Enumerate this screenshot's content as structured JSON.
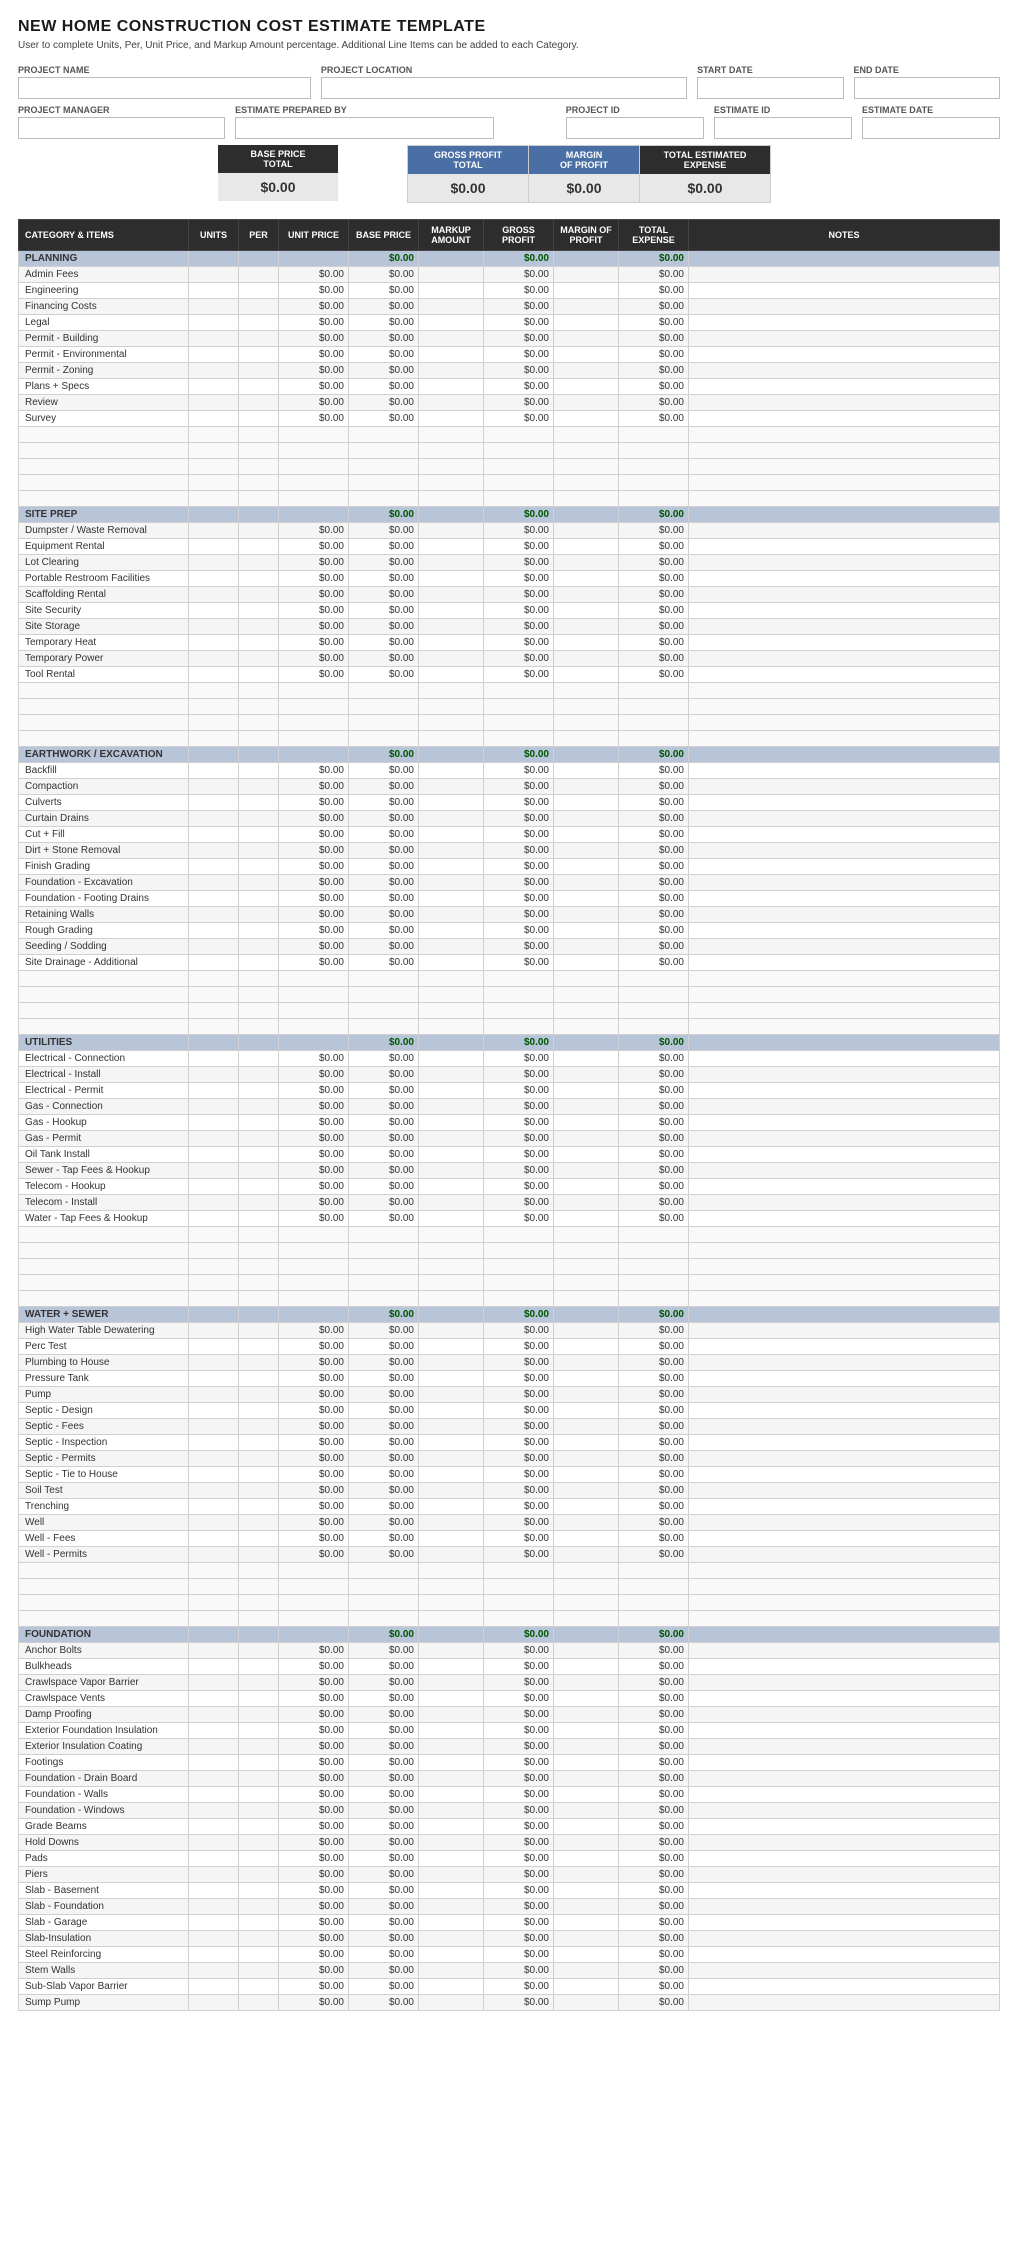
{
  "title": "NEW HOME CONSTRUCTION COST ESTIMATE TEMPLATE",
  "subtitle": "User to complete Units, Per, Unit Price, and Markup Amount percentage.  Additional Line Items can be added to each Category.",
  "form": {
    "project_name_label": "PROJECT NAME",
    "project_location_label": "PROJECT LOCATION",
    "start_date_label": "START DATE",
    "end_date_label": "END DATE",
    "project_manager_label": "PROJECT MANAGER",
    "estimate_prepared_label": "ESTIMATE PREPARED BY",
    "project_id_label": "PROJECT ID",
    "estimate_id_label": "ESTIMATE ID",
    "estimate_date_label": "ESTIMATE DATE"
  },
  "summary": {
    "base_price_label": "BASE PRICE\nTOTAL",
    "base_price_value": "$0.00",
    "gross_profit_label": "GROSS PROFIT\nTOTAL",
    "gross_profit_value": "$0.00",
    "margin_of_profit_label": "MARGIN\nOF PROFIT",
    "margin_of_profit_value": "$0.00",
    "total_estimated_label": "TOTAL ESTIMATED\nEXPENSE",
    "total_estimated_value": "$0.00"
  },
  "table": {
    "headers": [
      "CATEGORY & ITEMS",
      "UNITS",
      "PER",
      "UNIT PRICE",
      "BASE PRICE",
      "MARKUP AMOUNT",
      "GROSS PROFIT",
      "MARGIN OF PROFIT",
      "TOTAL EXPENSE",
      "NOTES"
    ],
    "sections": [
      {
        "category": "PLANNING",
        "items": [
          "Admin Fees",
          "Engineering",
          "Financing Costs",
          "Legal",
          "Permit - Building",
          "Permit - Environmental",
          "Permit - Zoning",
          "Plans + Specs",
          "Review",
          "Survey",
          "",
          "",
          "",
          "",
          ""
        ]
      },
      {
        "category": "SITE PREP",
        "items": [
          "Dumpster / Waste Removal",
          "Equipment Rental",
          "Lot Clearing",
          "Portable Restroom Facilities",
          "Scaffolding Rental",
          "Site Security",
          "Site Storage",
          "Temporary Heat",
          "Temporary Power",
          "Tool Rental",
          "",
          "",
          "",
          ""
        ]
      },
      {
        "category": "EARTHWORK / EXCAVATION",
        "items": [
          "Backfill",
          "Compaction",
          "Culverts",
          "Curtain Drains",
          "Cut + Fill",
          "Dirt + Stone Removal",
          "Finish Grading",
          "Foundation - Excavation",
          "Foundation - Footing Drains",
          "Retaining Walls",
          "Rough Grading",
          "Seeding / Sodding",
          "Site Drainage - Additional",
          "",
          "",
          "",
          ""
        ]
      },
      {
        "category": "UTILITIES",
        "items": [
          "Electrical - Connection",
          "Electrical - Install",
          "Electrical - Permit",
          "Gas - Connection",
          "Gas - Hookup",
          "Gas - Permit",
          "Oil Tank Install",
          "Sewer - Tap Fees & Hookup",
          "Telecom - Hookup",
          "Telecom - Install",
          "Water - Tap Fees & Hookup",
          "",
          "",
          "",
          "",
          ""
        ]
      },
      {
        "category": "WATER + SEWER",
        "items": [
          "High Water Table Dewatering",
          "Perc Test",
          "Plumbing to House",
          "Pressure Tank",
          "Pump",
          "Septic - Design",
          "Septic - Fees",
          "Septic - Inspection",
          "Septic - Permits",
          "Septic - Tie to House",
          "Soil Test",
          "Trenching",
          "Well",
          "Well - Fees",
          "Well - Permits",
          "",
          "",
          "",
          ""
        ]
      },
      {
        "category": "FOUNDATION",
        "items": [
          "Anchor Bolts",
          "Bulkheads",
          "Crawlspace Vapor Barrier",
          "Crawlspace Vents",
          "Damp Proofing",
          "Exterior Foundation Insulation",
          "Exterior Insulation Coating",
          "Footings",
          "Foundation - Drain Board",
          "Foundation - Walls",
          "Foundation - Windows",
          "Grade Beams",
          "Hold Downs",
          "Pads",
          "Piers",
          "Slab - Basement",
          "Slab - Foundation",
          "Slab - Garage",
          "Slab-Insulation",
          "Steel Reinforcing",
          "Stem Walls",
          "Sub-Slab Vapor Barrier",
          "Sump Pump"
        ]
      }
    ],
    "zero_value": "$0.00"
  }
}
